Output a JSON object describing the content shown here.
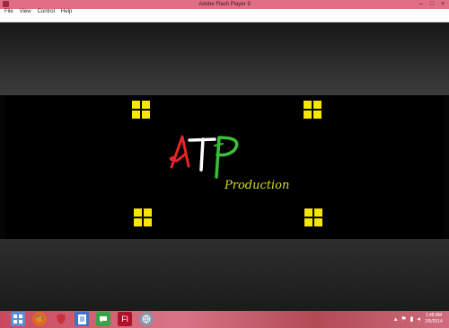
{
  "window": {
    "title": "Adobe Flash Player 9",
    "minimize_glyph": "–",
    "maximize_glyph": "□",
    "close_glyph": "×"
  },
  "menu": [
    {
      "label": "File"
    },
    {
      "label": "View"
    },
    {
      "label": "Control"
    },
    {
      "label": "Help"
    }
  ],
  "movie": {
    "logo_text": "ATP",
    "logo_colors": [
      "#e8242a",
      "#ffffff",
      "#3bbf3a"
    ],
    "subtitle": "Production",
    "window_icon_color": "#f7e600"
  },
  "taskbar": {
    "apps": [
      {
        "icon": "start-icon",
        "color": "#5e8fd6"
      },
      {
        "icon": "file-explorer-icon",
        "color": "#e8b94a"
      },
      {
        "icon": "firefox-icon",
        "color": "#e06a1f"
      },
      {
        "icon": "shield-icon",
        "color": "#c8303b"
      },
      {
        "icon": "document-icon",
        "color": "#3f73c8"
      },
      {
        "icon": "chat-icon",
        "color": "#3ca04a"
      },
      {
        "icon": "flash-icon",
        "color": "#b0102a",
        "glyph": "Fl"
      },
      {
        "icon": "globe-icon",
        "color": "#8895a8"
      }
    ],
    "clock_time": "1:48 AM",
    "clock_date": "2/5/2014"
  }
}
